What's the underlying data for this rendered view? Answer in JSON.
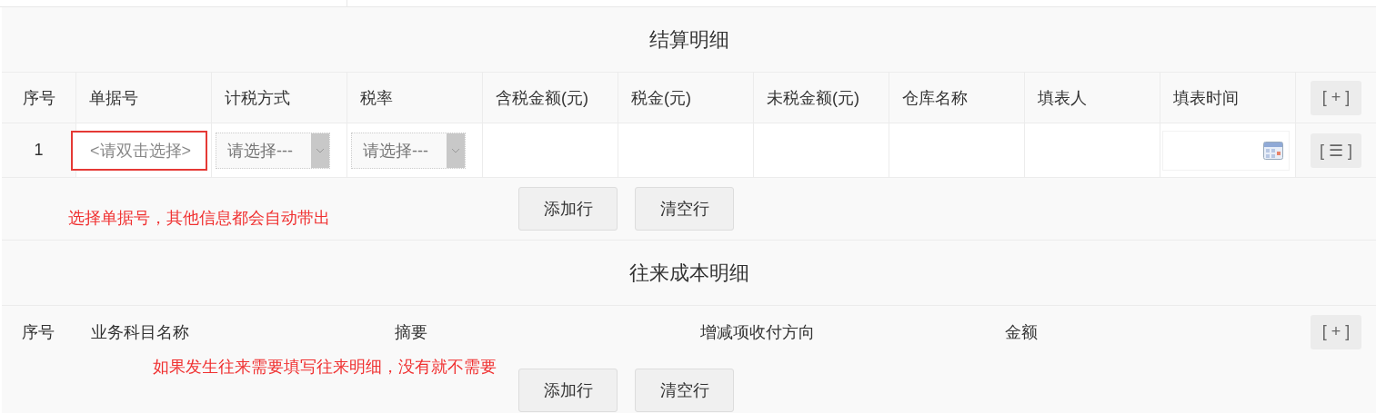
{
  "sections": [
    {
      "kind": "grid",
      "title": "结算明细",
      "columns": [
        "序号",
        "单据号",
        "计税方式",
        "税率",
        "含税金额(元)",
        "税金(元)",
        "未税金额(元)",
        "仓库名称",
        "填表人",
        "填表时间"
      ],
      "add_button": "[ + ]",
      "rows": [
        {
          "cells": [
            {
              "kind": "text",
              "text": "1"
            },
            {
              "kind": "picker",
              "placeholder": "<请双击选择>",
              "highlighted": true
            },
            {
              "kind": "select",
              "placeholder": "请选择---"
            },
            {
              "kind": "select",
              "placeholder": "请选择---"
            },
            {
              "kind": "empty"
            },
            {
              "kind": "empty"
            },
            {
              "kind": "empty"
            },
            {
              "kind": "empty"
            },
            {
              "kind": "empty"
            },
            {
              "kind": "date"
            }
          ],
          "action": "[ ☰ ]"
        }
      ],
      "note": "选择单据号，其他信息都会自动带出",
      "buttons": [
        "添加行",
        "清空行"
      ]
    },
    {
      "kind": "plain",
      "title": "往来成本明细",
      "columns": [
        "序号",
        "业务科目名称",
        "摘要",
        "增减项收付方向",
        "金额"
      ],
      "add_button": "[ + ]",
      "note": "如果发生往来需要填写往来明细，没有就不需要",
      "buttons": [
        "添加行",
        "清空行"
      ]
    }
  ]
}
